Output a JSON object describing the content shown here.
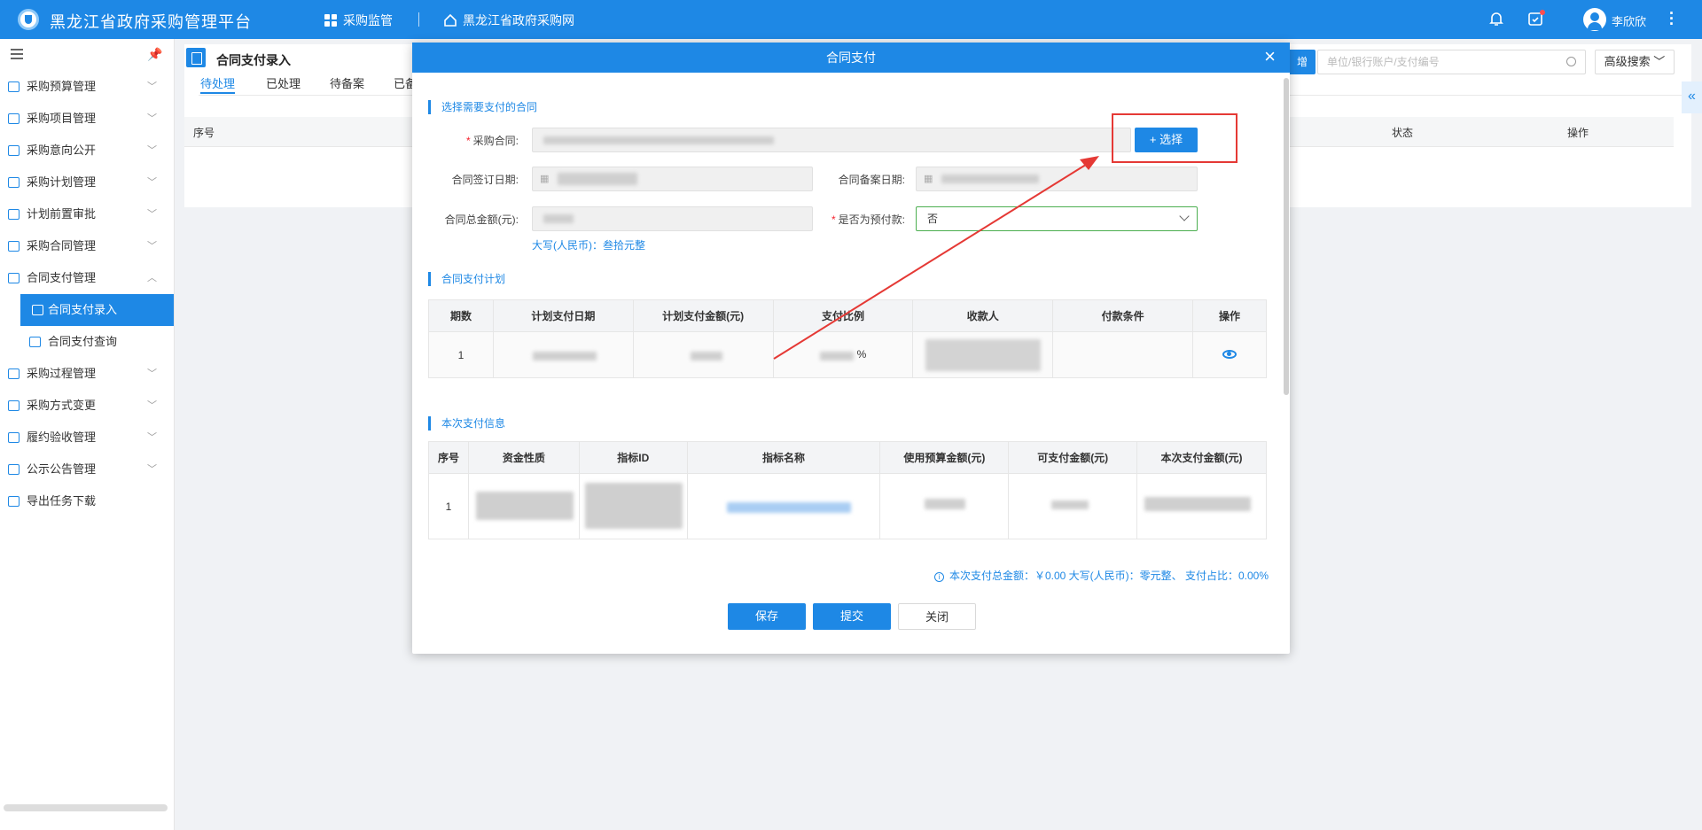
{
  "app": {
    "title": "黑龙江省政府采购管理平台"
  },
  "topnav": {
    "monitor": "采购监管",
    "portal": "黑龙江省政府采购网"
  },
  "user": {
    "name": "李欣欣"
  },
  "sidebar": {
    "items": [
      {
        "label": "采购预算管理",
        "icon": "budget-icon"
      },
      {
        "label": "采购项目管理",
        "icon": "project-icon"
      },
      {
        "label": "采购意向公开",
        "icon": "intent-icon"
      },
      {
        "label": "采购计划管理",
        "icon": "plan-icon"
      },
      {
        "label": "计划前置审批",
        "icon": "approval-icon"
      },
      {
        "label": "采购合同管理",
        "icon": "contract-icon"
      },
      {
        "label": "合同支付管理",
        "icon": "payment-icon"
      },
      {
        "label": "合同支付录入",
        "icon": "entry-icon"
      },
      {
        "label": "合同支付查询",
        "icon": "query-icon"
      },
      {
        "label": "采购过程管理",
        "icon": "process-icon"
      },
      {
        "label": "采购方式变更",
        "icon": "method-icon"
      },
      {
        "label": "履约验收管理",
        "icon": "acceptance-icon"
      },
      {
        "label": "公示公告管理",
        "icon": "notice-icon"
      },
      {
        "label": "导出任务下载",
        "icon": "download-icon"
      }
    ]
  },
  "page": {
    "title": "合同支付录入",
    "tabs": [
      "待处理",
      "已处理",
      "待备案",
      "已备"
    ],
    "search_placeholder": "单位/银行账户/支付编号",
    "advanced_search": "高级搜索",
    "edge_button": "增",
    "columns": {
      "no": "序号",
      "status": "状态",
      "action": "操作"
    }
  },
  "dialog": {
    "title": "合同支付",
    "section_contract": "选择需要支付的合同",
    "label_contract": "采购合同:",
    "select_button": "+ 选择",
    "label_sign_date": "合同签订日期:",
    "label_file_date": "合同备案日期:",
    "label_total": "合同总金额(元):",
    "label_prepay": "是否为预付款:",
    "prepay_value": "否",
    "daxie": "大写(人民币)：叁拾元整",
    "section_plan": "合同支付计划",
    "plan_headers": [
      "期数",
      "计划支付日期",
      "计划支付金额(元)",
      "支付比例",
      "收款人",
      "付款条件",
      "操作"
    ],
    "plan_rows": [
      {
        "period": "1",
        "ratio_suffix": "%"
      }
    ],
    "section_current": "本次支付信息",
    "current_headers": [
      "序号",
      "资金性质",
      "指标ID",
      "指标名称",
      "使用预算金额(元)",
      "可支付金额(元)",
      "本次支付金额(元)"
    ],
    "current_rows": [
      {
        "no": "1"
      }
    ],
    "summary": "本次支付总金额：￥0.00 大写(人民币)：零元整、 支付占比：0.00%",
    "buttons": {
      "save": "保存",
      "submit": "提交",
      "close": "关闭"
    }
  },
  "colors": {
    "primary": "#1e88e5",
    "annotation": "#e53935",
    "valid_border": "#4caf50"
  }
}
